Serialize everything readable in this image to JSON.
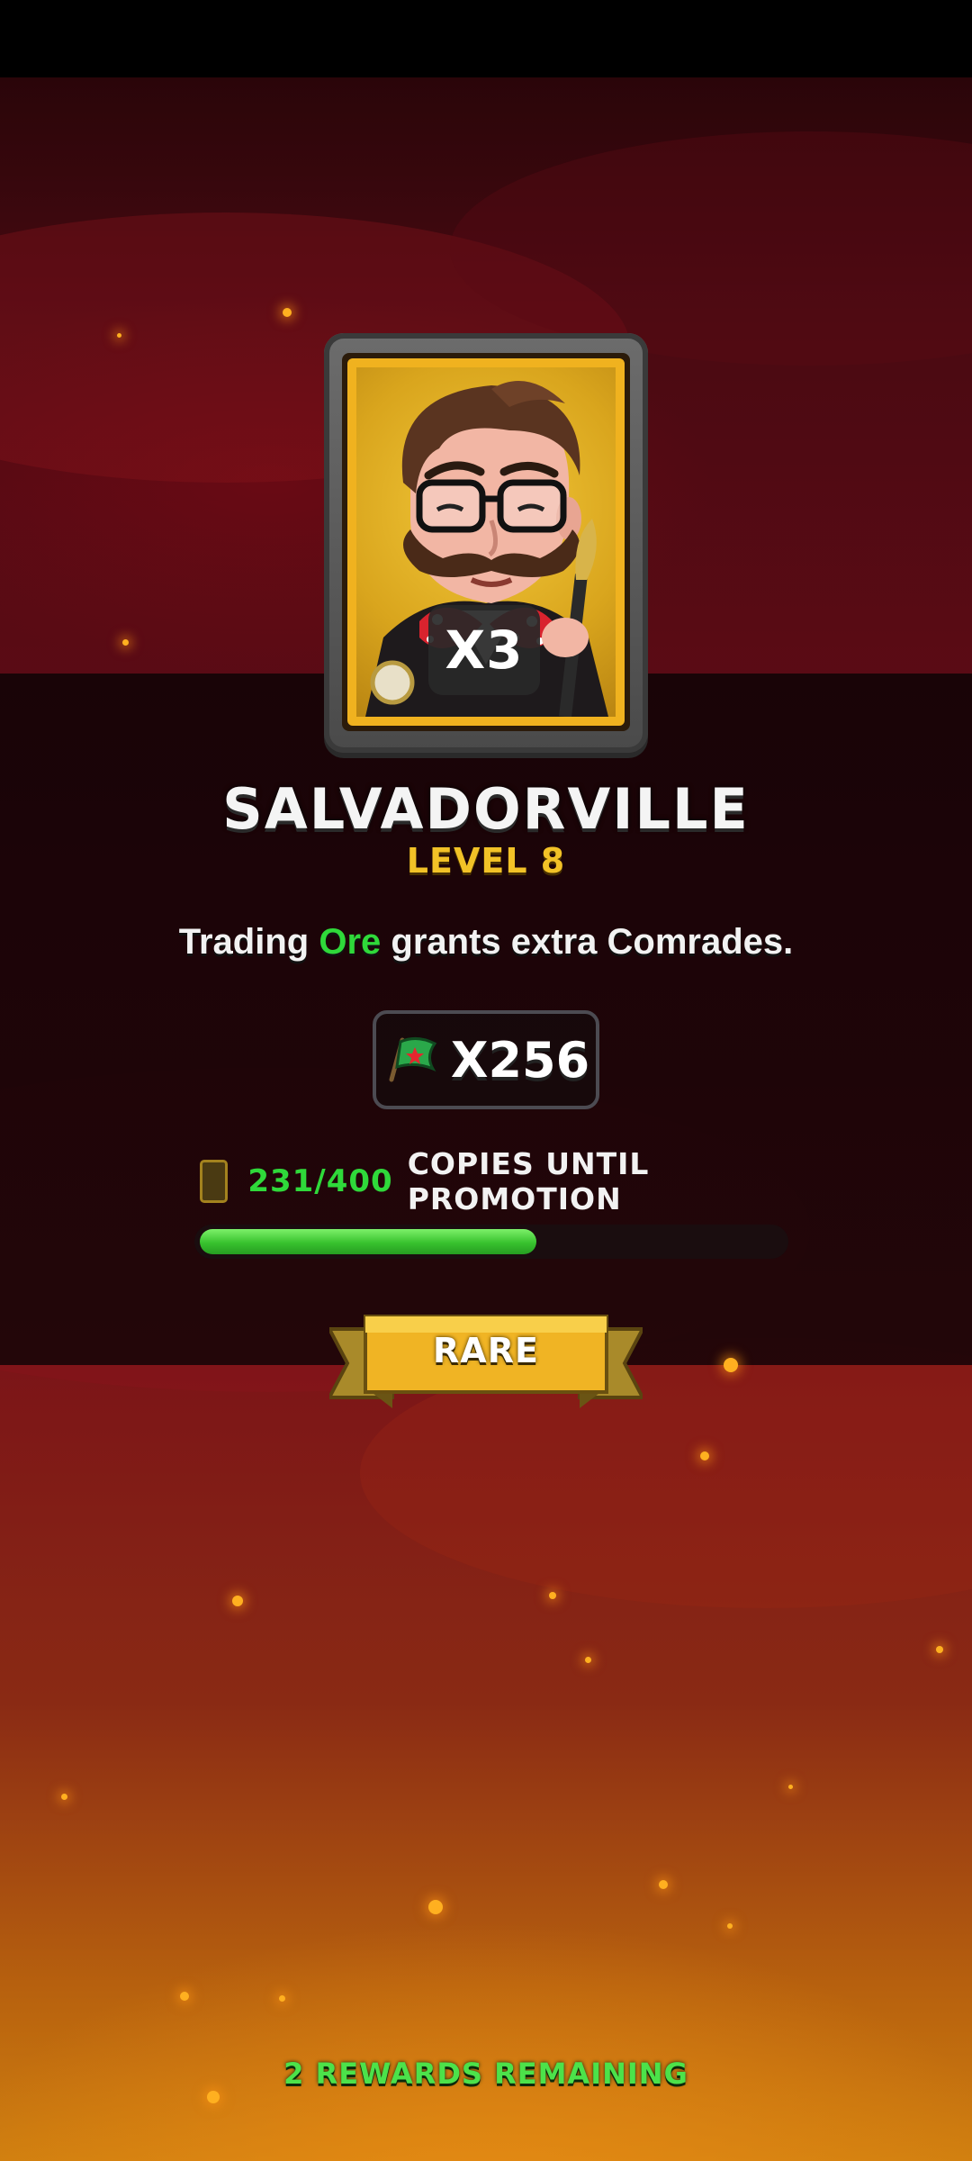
{
  "hero": {
    "name": "SALVADORVILLE",
    "level_label": "LEVEL 8",
    "multiplier": "X3",
    "rarity": "RARE",
    "description": {
      "before": "Trading ",
      "highlight": "Ore",
      "after": " grants extra Comrades."
    }
  },
  "reward": {
    "icon": "flag-icon",
    "count": "X256"
  },
  "promotion": {
    "copies_text": "231/400",
    "label": "COPIES UNTIL PROMOTION",
    "current": 231,
    "total": 400
  },
  "footer": {
    "remaining_text": "2 REWARDS REMAINING"
  },
  "colors": {
    "accent_gold": "#f2c227",
    "accent_green": "#2fd93a",
    "background_red": "#6a0d18"
  }
}
